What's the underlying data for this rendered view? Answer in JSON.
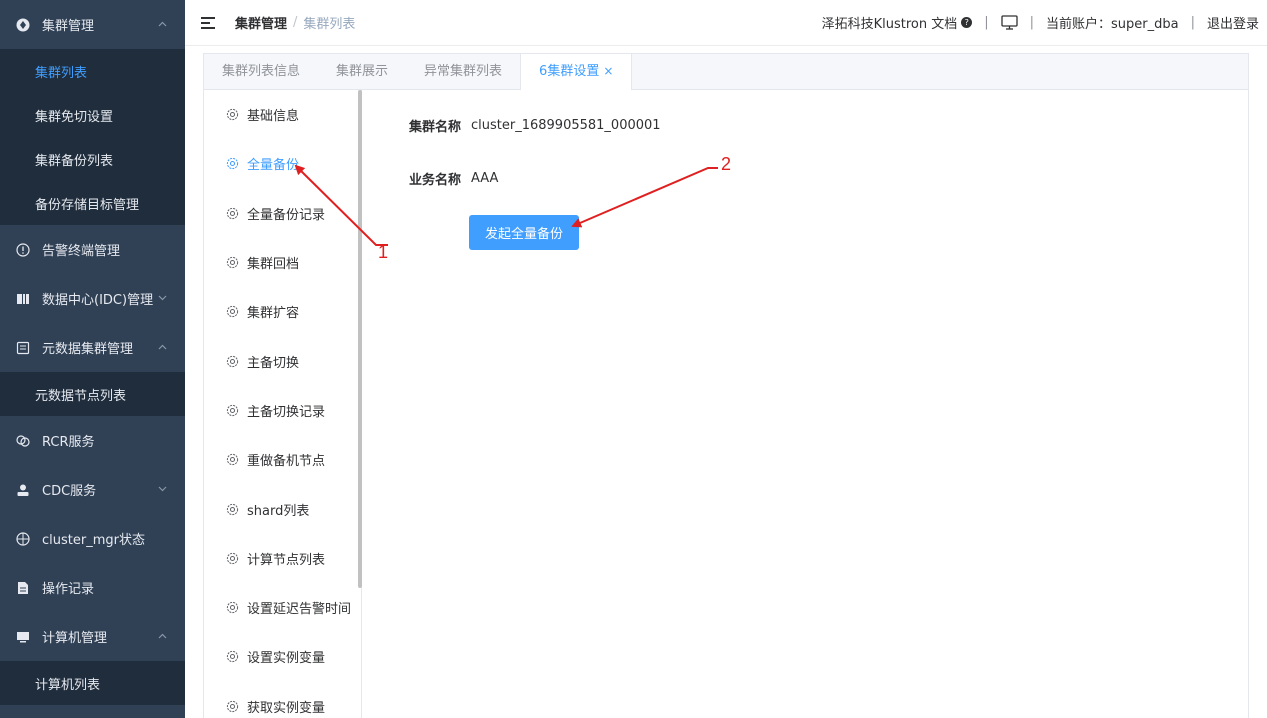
{
  "sidebar": {
    "items": [
      {
        "type": "menu",
        "label": "集群管理",
        "icon": "cluster-icon",
        "chevron": "up"
      },
      {
        "type": "sub",
        "label": "集群列表",
        "active": true
      },
      {
        "type": "sub",
        "label": "集群免切设置"
      },
      {
        "type": "sub",
        "label": "集群备份列表"
      },
      {
        "type": "sub",
        "label": "备份存储目标管理"
      },
      {
        "type": "menu",
        "label": "告警终端管理",
        "icon": "alert-icon"
      },
      {
        "type": "menu",
        "label": "数据中心(IDC)管理",
        "icon": "datacenter-icon",
        "chevron": "down"
      },
      {
        "type": "menu",
        "label": "元数据集群管理",
        "icon": "metadata-icon",
        "chevron": "up"
      },
      {
        "type": "sub",
        "label": "元数据节点列表"
      },
      {
        "type": "menu",
        "label": "RCR服务",
        "icon": "rcr-icon"
      },
      {
        "type": "menu",
        "label": "CDC服务",
        "icon": "user-icon",
        "chevron": "down"
      },
      {
        "type": "menu",
        "label": "cluster_mgr状态",
        "icon": "crosshair-icon"
      },
      {
        "type": "menu",
        "label": "操作记录",
        "icon": "document-icon"
      },
      {
        "type": "menu",
        "label": "计算机管理",
        "icon": "computer-icon",
        "chevron": "up"
      },
      {
        "type": "sub",
        "label": "计算机列表"
      }
    ]
  },
  "header": {
    "breadcrumb_root": "集群管理",
    "breadcrumb_sep": "/",
    "breadcrumb_current": "集群列表",
    "docs_label": "泽拓科技Klustron 文档",
    "divider": "|",
    "account_label": "当前账户：super_dba",
    "logout_label": "退出登录"
  },
  "tabs": [
    {
      "label": "集群列表信息"
    },
    {
      "label": "集群展示"
    },
    {
      "label": "异常集群列表"
    },
    {
      "label": "6集群设置",
      "active": true,
      "closable": true
    }
  ],
  "tab_close_glyph": "×",
  "left_nav": [
    {
      "label": "基础信息"
    },
    {
      "label": "全量备份",
      "active": true
    },
    {
      "label": "全量备份记录"
    },
    {
      "label": "集群回档"
    },
    {
      "label": "集群扩容"
    },
    {
      "label": "主备切换"
    },
    {
      "label": "主备切换记录"
    },
    {
      "label": "重做备机节点"
    },
    {
      "label": "shard列表"
    },
    {
      "label": "计算节点列表"
    },
    {
      "label": "设置延迟告警时间"
    },
    {
      "label": "设置实例变量"
    },
    {
      "label": "获取实例变量"
    }
  ],
  "form": {
    "cluster_name_label": "集群名称",
    "cluster_name_value": "cluster_1689905581_000001",
    "business_name_label": "业务名称",
    "business_name_value": "AAA",
    "submit_label": "发起全量备份"
  },
  "annotations": {
    "marker_1": "1",
    "marker_2": "2",
    "color": "#e02020"
  },
  "colors": {
    "sidebar_bg": "#304156",
    "submenu_bg": "#1f2d3d",
    "accent": "#409eff"
  }
}
